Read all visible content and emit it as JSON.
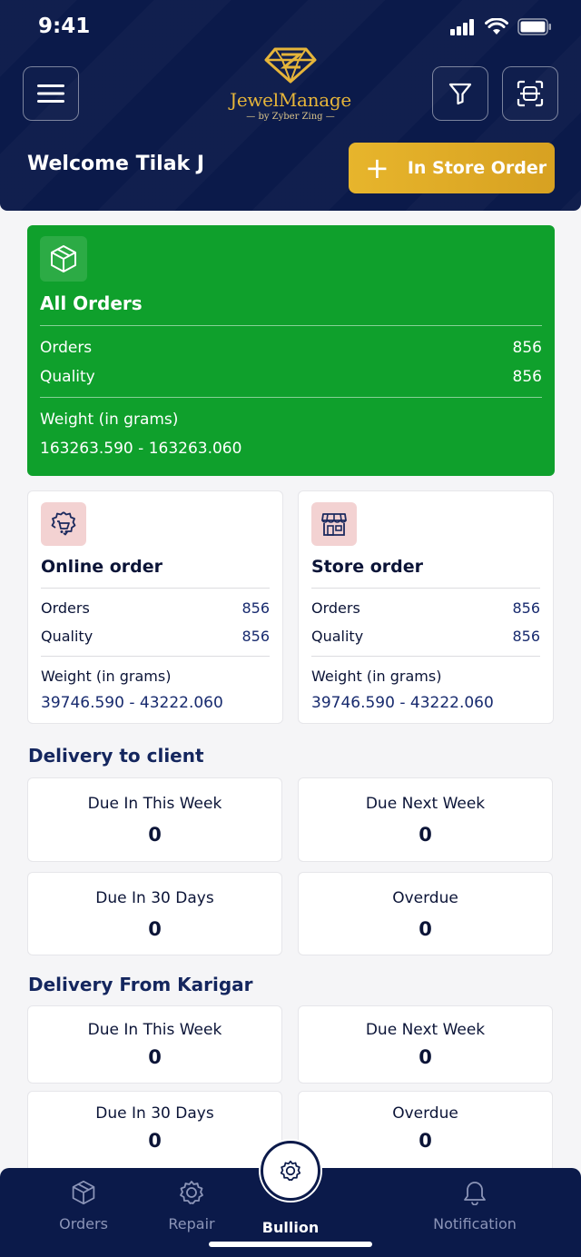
{
  "status": {
    "time": "9:41"
  },
  "header": {
    "logo_name": "JewelManage",
    "logo_sub": "— by Zyber Zing —",
    "welcome": "Welcome Tilak J",
    "store_button": "In Store Order"
  },
  "icons": {
    "menu": "hamburger-menu-icon",
    "filter": "filter-icon",
    "scan": "scan-icon",
    "box": "package-icon",
    "online": "gear-cart-icon",
    "store": "storefront-icon"
  },
  "all_orders": {
    "title": "All Orders",
    "orders_label": "Orders",
    "orders_value": "856",
    "quality_label": "Quality",
    "quality_value": "856",
    "weight_label": "Weight (in grams)",
    "weight_value": "163263.590 - 163263.060"
  },
  "online_order": {
    "title": "Online order",
    "orders_label": "Orders",
    "orders_value": "856",
    "quality_label": "Quality",
    "quality_value": "856",
    "weight_label": "Weight (in grams)",
    "weight_value": "39746.590 - 43222.060"
  },
  "store_order": {
    "title": "Store order",
    "orders_label": "Orders",
    "orders_value": "856",
    "quality_label": "Quality",
    "quality_value": "856",
    "weight_label": "Weight (in grams)",
    "weight_value": "39746.590 - 43222.060"
  },
  "delivery_client": {
    "title": "Delivery to client",
    "items": [
      {
        "label": "Due In This Week",
        "value": "0"
      },
      {
        "label": "Due Next Week",
        "value": "0"
      },
      {
        "label": "Due In 30 Days",
        "value": "0"
      },
      {
        "label": "Overdue",
        "value": "0"
      }
    ]
  },
  "delivery_karigar": {
    "title": "Delivery From Karigar",
    "items": [
      {
        "label": "Due In This Week",
        "value": "0"
      },
      {
        "label": "Due Next Week",
        "value": "0"
      },
      {
        "label": "Due In 30 Days",
        "value": "0"
      },
      {
        "label": "Overdue",
        "value": "0"
      }
    ]
  },
  "tabbar": {
    "orders": "Orders",
    "repair": "Repair",
    "bullion": "Bullion",
    "notification": "Notification"
  },
  "colors": {
    "navy": "#0b1a4a",
    "gold": "#e6b53a",
    "green": "#0fa02c",
    "pink": "#f3d2d2"
  }
}
